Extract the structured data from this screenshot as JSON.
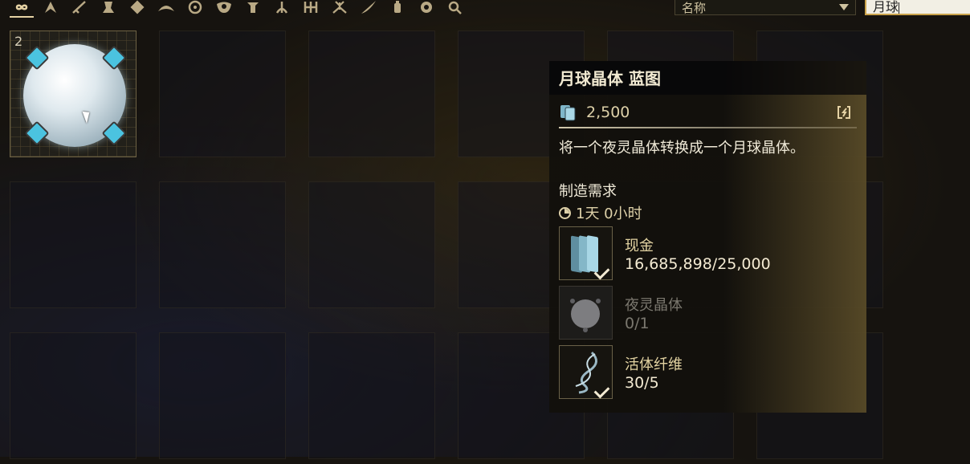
{
  "categories": [
    {
      "icon": "infinity-icon",
      "active": true
    },
    {
      "icon": "warframe-icon"
    },
    {
      "icon": "sword-icon"
    },
    {
      "icon": "sentinel-icon"
    },
    {
      "icon": "gear-items-icon"
    },
    {
      "icon": "archwing-icon"
    },
    {
      "icon": "wheel-icon"
    },
    {
      "icon": "mask-icon"
    },
    {
      "icon": "pillar-icon"
    },
    {
      "icon": "tree-icon"
    },
    {
      "icon": "crest-icon"
    },
    {
      "icon": "spider-icon"
    },
    {
      "icon": "feather-icon"
    },
    {
      "icon": "lantern-icon"
    },
    {
      "icon": "shield-icon"
    },
    {
      "icon": "key-icon"
    }
  ],
  "sort": {
    "value": "名称"
  },
  "search": {
    "value": "月球"
  },
  "inventory": {
    "item": {
      "quantity": "2",
      "name": "月球晶体"
    }
  },
  "tooltip": {
    "title": "月球晶体 蓝图",
    "price": "2,500",
    "description": "将一个夜灵晶体转换成一个月球晶体。",
    "section_label": "制造需求",
    "build_time": "1天 0小时",
    "requirements": [
      {
        "name": "现金",
        "value": "16,685,898/25,000",
        "met": true,
        "icon": "credits-icon"
      },
      {
        "name": "夜灵晶体",
        "value": "0/1",
        "met": false,
        "icon": "nightmare-crystal-icon"
      },
      {
        "name": "活体纤维",
        "value": "30/5",
        "met": true,
        "icon": "fiber-icon"
      }
    ]
  },
  "colors": {
    "accent": "#c9a24a",
    "text_gold": "#e3d3a2",
    "disabled": "#7b786f"
  }
}
